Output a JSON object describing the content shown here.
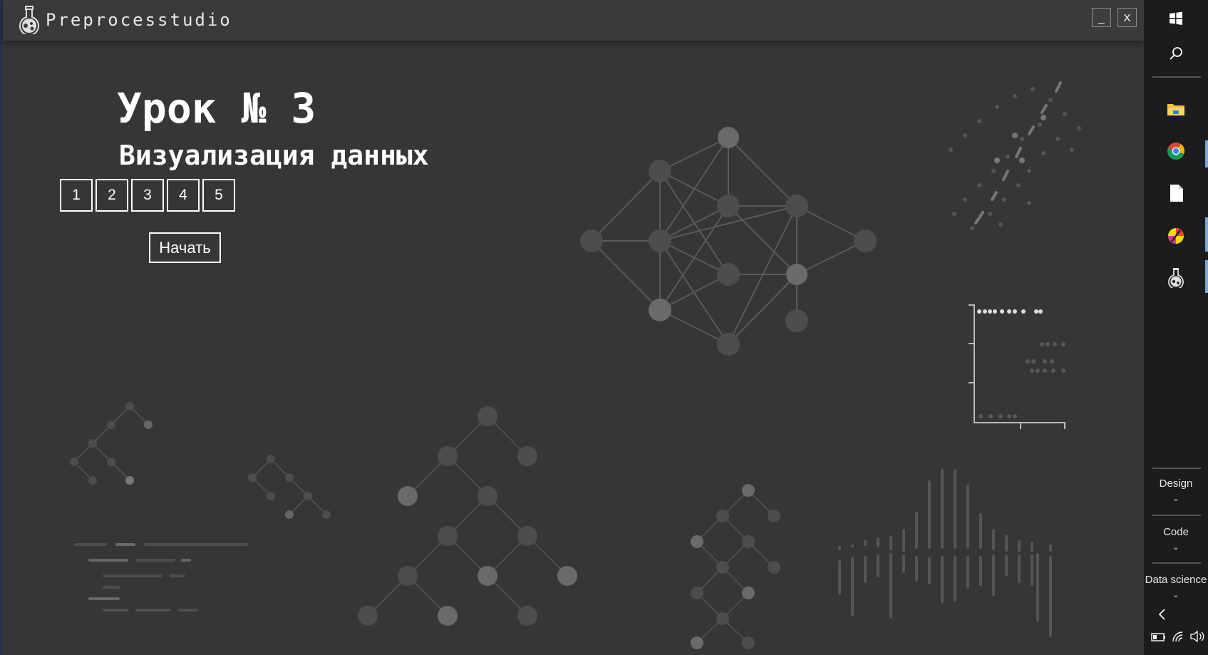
{
  "window": {
    "title": "Preprocesstudio",
    "minimize_label": "_",
    "close_label": "X"
  },
  "lesson": {
    "title": "Урок № 3",
    "subtitle": "Визуализация данных",
    "pages": [
      "1",
      "2",
      "3",
      "4",
      "5"
    ],
    "start_label": "Начать"
  },
  "taskbar": {
    "pinned": [
      {
        "name": "file-explorer-icon"
      },
      {
        "name": "chrome-icon"
      },
      {
        "name": "document-icon"
      },
      {
        "name": "colorful-app-icon"
      },
      {
        "name": "preprocesstudio-icon"
      }
    ],
    "menus": [
      {
        "label": "Design"
      },
      {
        "label": "Code"
      },
      {
        "label": "Data science"
      }
    ],
    "chevron": "⌄"
  },
  "colors": {
    "app_bg": "#363636",
    "titlebar_bg": "#3a3a3a",
    "taskbar_bg": "#1c1c1c",
    "text": "#ffffff",
    "art_gray": "#555555"
  }
}
